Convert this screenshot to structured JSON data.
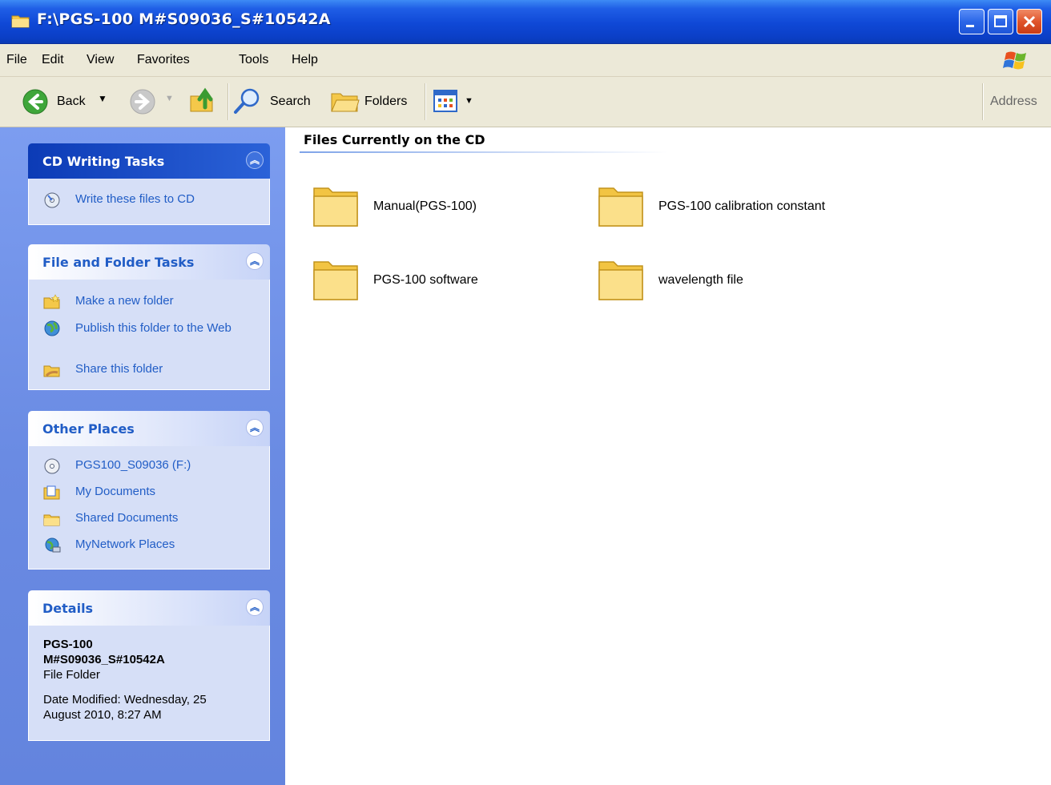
{
  "window": {
    "title": "F:\\PGS-100 M#S09036_S#10542A",
    "controls": [
      "minimize-icon",
      "maximize-icon",
      "close-icon"
    ]
  },
  "menu": [
    "File",
    "Edit",
    "View",
    "Favorites",
    "Tools",
    "Help"
  ],
  "toolbar": {
    "back_label": "Back",
    "search_label": "Search",
    "folders_label": "Folders",
    "address_label": "Address"
  },
  "panels": {
    "cd_writing": {
      "title": "CD Writing Tasks",
      "items": [
        {
          "label": "Write these files to CD",
          "icon": "cd-write-icon"
        }
      ]
    },
    "file_folder": {
      "title": "File and Folder Tasks",
      "items": [
        {
          "label": "Make a new folder",
          "icon": "new-folder-icon"
        },
        {
          "label": "Publish this folder to the Web",
          "icon": "publish-web-icon"
        },
        {
          "label": "Share this folder",
          "icon": "share-folder-icon"
        }
      ]
    },
    "other_places": {
      "title": "Other Places",
      "items": [
        {
          "label": "PGS100_S09036 (F:)",
          "icon": "cd-drive-icon"
        },
        {
          "label": "My Documents",
          "icon": "my-documents-icon"
        },
        {
          "label": "Shared Documents",
          "icon": "shared-folder-icon"
        },
        {
          "label": "MyNetwork Places",
          "icon": "network-places-icon"
        }
      ]
    },
    "details": {
      "title": "Details",
      "name_line1": "PGS-100",
      "name_line2": "M#S09036_S#10542A",
      "type": "File Folder",
      "modified_line1": "Date Modified: Wednesday, 25",
      "modified_line2": "August 2010, 8:27 AM"
    }
  },
  "content": {
    "section_title": "Files Currently on the CD",
    "folders": [
      "Manual(PGS-100)",
      "PGS-100 calibration constant",
      "PGS-100 software",
      "wavelength file"
    ]
  },
  "colors": {
    "titlebar": "#0b3fc7",
    "taskpane": "#6a8be3",
    "panel_link": "#215dc6",
    "chrome": "#ece9d8"
  }
}
